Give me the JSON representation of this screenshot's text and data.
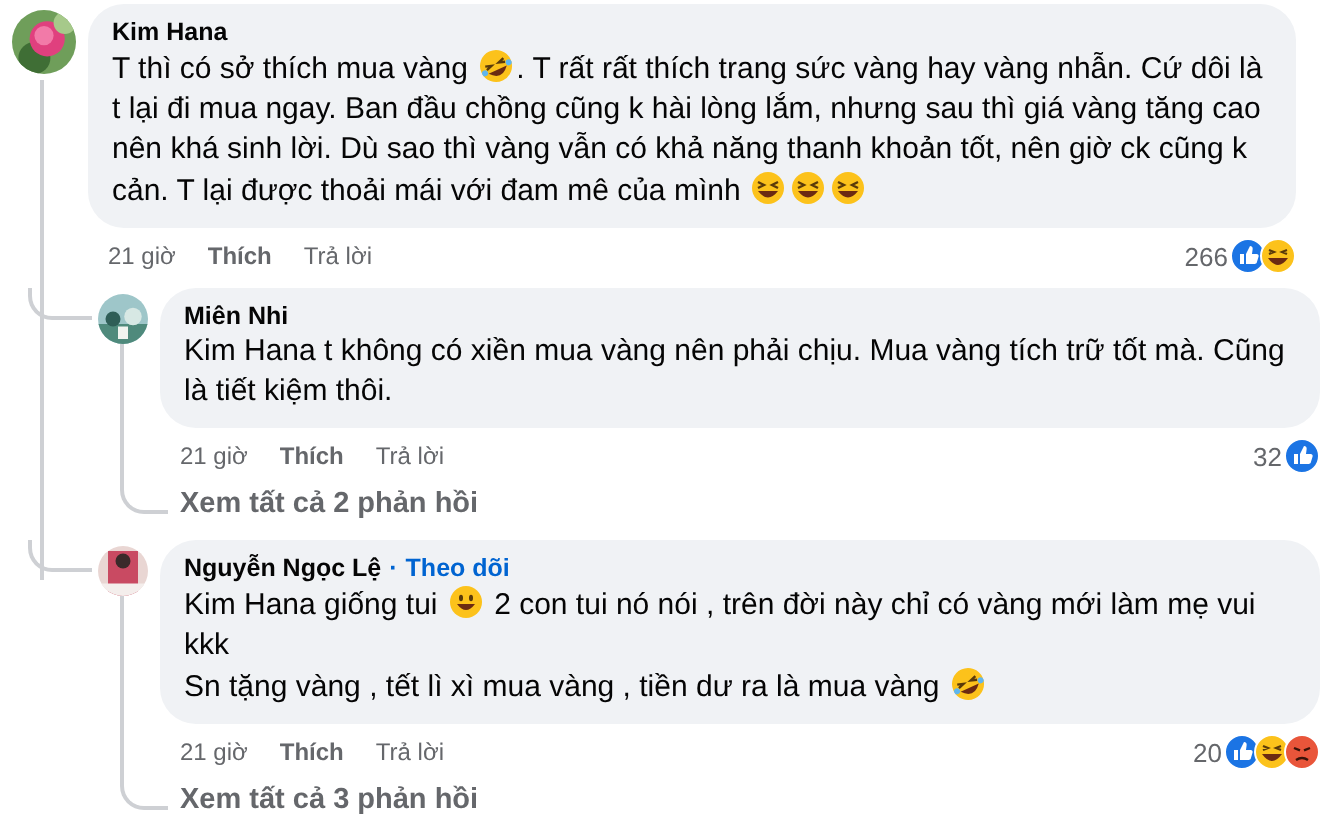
{
  "comments": [
    {
      "kind": "top",
      "author": {
        "name": "Kim Hana"
      },
      "paragraphs": [
        [
          {
            "kind": "text",
            "text": "T thì có sở thích mua vàng "
          },
          {
            "kind": "rofl_emoji"
          },
          {
            "kind": "text",
            "text": ". T rất rất thích trang sức vàng hay vàng nhẫn. Cứ dôi là t lại đi mua ngay. Ban đầu chồng cũng k hài lòng lắm, nhưng sau thì giá vàng tăng cao nên khá sinh lời. Dù sao thì vàng vẫn có khả năng thanh khoản tốt, nên giờ ck cũng k cản. T lại được thoải mái với đam mê của mình "
          },
          {
            "kind": "laugh_emoji"
          },
          {
            "kind": "laugh_emoji"
          },
          {
            "kind": "laugh_emoji"
          }
        ]
      ],
      "time": "21 giờ",
      "like_label": "Thích",
      "reply_label": "Trả lời",
      "reaction_count": "266",
      "reactions": [
        {
          "kind": "like"
        },
        {
          "kind": "haha"
        }
      ],
      "replies": [
        {
          "kind": "reply",
          "author": {
            "name": "Miên Nhi"
          },
          "paragraphs": [
            [
              {
                "kind": "mention",
                "text": "Kim Hana"
              },
              {
                "kind": "text",
                "text": " t không có xiền mua vàng nên phải chịu. Mua vàng tích trữ tốt mà. Cũng là tiết kiệm thôi."
              }
            ]
          ],
          "time": "21 giờ",
          "like_label": "Thích",
          "reply_label": "Trả lời",
          "reaction_count": "32",
          "reactions": [
            {
              "kind": "like"
            }
          ],
          "view_replies": "Xem tất cả 2 phản hồi"
        },
        {
          "kind": "reply",
          "author": {
            "name": "Nguyễn Ngọc Lệ"
          },
          "follow": {
            "separator": "·",
            "label": "Theo dõi"
          },
          "paragraphs": [
            [
              {
                "kind": "mention",
                "text": "Kim Hana"
              },
              {
                "kind": "text",
                "text": " giống tui "
              },
              {
                "kind": "smile_emoji"
              },
              {
                "kind": "text",
                "text": " 2 con tui nó nói , trên đời này chỉ có vàng mới làm mẹ vui kkk"
              }
            ],
            [
              {
                "kind": "text",
                "text": "Sn tặng vàng , tết lì xì mua vàng , tiền dư ra là mua vàng "
              },
              {
                "kind": "rofl_emoji"
              }
            ]
          ],
          "time": "21 giờ",
          "like_label": "Thích",
          "reply_label": "Trả lời",
          "reaction_count": "20",
          "reactions": [
            {
              "kind": "like"
            },
            {
              "kind": "haha"
            },
            {
              "kind": "angry"
            }
          ],
          "view_replies": "Xem tất cả 3 phản hồi"
        }
      ]
    }
  ]
}
